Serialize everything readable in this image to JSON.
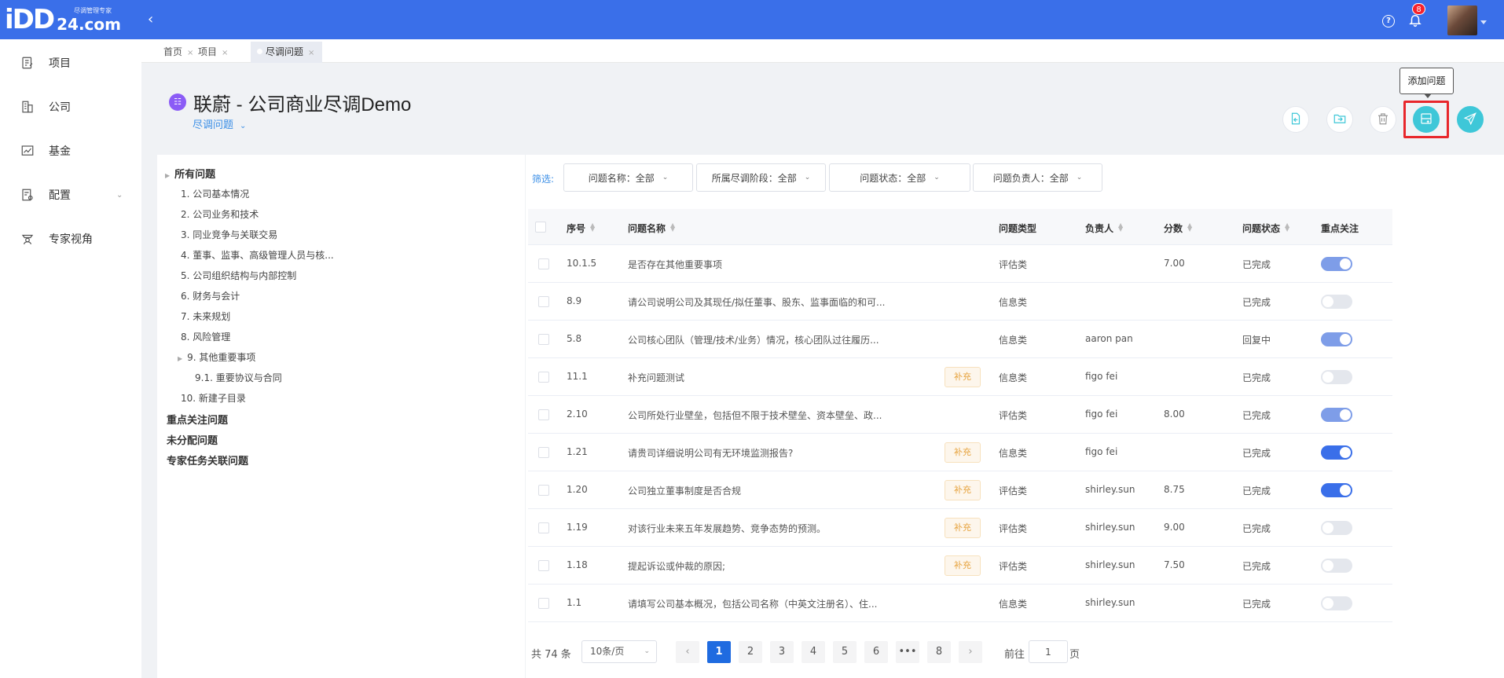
{
  "header": {
    "logo_mark": "iDD",
    "logo_domain": "24.com",
    "logo_tagline": "尽调管理专家",
    "notification_count": "8"
  },
  "sidebar": {
    "items": [
      {
        "label": "项目",
        "icon": "edit-doc-icon"
      },
      {
        "label": "公司",
        "icon": "building-icon"
      },
      {
        "label": "基金",
        "icon": "chart-icon"
      },
      {
        "label": "配置",
        "icon": "settings-doc-icon"
      },
      {
        "label": "专家视角",
        "icon": "expert-icon"
      }
    ]
  },
  "tabs": [
    {
      "label": "首页"
    },
    {
      "label": "项目"
    },
    {
      "label": "尽调问题"
    }
  ],
  "project": {
    "title": "联蔚 - 公司商业尽调Demo",
    "subtitle": "尽调问题"
  },
  "tooltip": "添加问题",
  "tree": {
    "root": "所有问题",
    "items": [
      "1. 公司基本情况",
      "2. 公司业务和技术",
      "3. 同业竞争与关联交易",
      "4. 董事、监事、高级管理人员与核...",
      "5. 公司组织结构与内部控制",
      "6. 财务与会计",
      "7. 未来规划",
      "8. 风险管理",
      "9. 其他重要事项",
      "9.1. 重要协议与合同",
      "10. 新建子目录"
    ],
    "groups": [
      "重点关注问题",
      "未分配问题",
      "专家任务关联问题"
    ]
  },
  "filters": {
    "label": "筛选:",
    "items": [
      "问题名称：全部",
      "所属尽调阶段：全部",
      "问题状态：全部",
      "问题负责人：全部"
    ]
  },
  "table": {
    "headers": [
      "序号",
      "问题名称",
      "问题类型",
      "负责人",
      "分数",
      "问题状态",
      "重点关注"
    ],
    "rows": [
      {
        "no": "10.1.5",
        "name": "是否存在其他重要事项",
        "tag": "",
        "type": "评估类",
        "owner": "",
        "score": "7.00",
        "status": "已完成",
        "focus": "on-light"
      },
      {
        "no": "8.9",
        "name": "请公司说明公司及其现任/拟任董事、股东、监事面临的和可...",
        "tag": "",
        "type": "信息类",
        "owner": "",
        "score": "",
        "status": "已完成",
        "focus": "off"
      },
      {
        "no": "5.8",
        "name": "公司核心团队（管理/技术/业务）情况，核心团队过往履历...",
        "tag": "",
        "type": "信息类",
        "owner": "aaron pan",
        "score": "",
        "status": "回复中",
        "focus": "on-light"
      },
      {
        "no": "11.1",
        "name": "补充问题测试",
        "tag": "补充",
        "type": "信息类",
        "owner": "figo fei",
        "score": "",
        "status": "已完成",
        "focus": "off"
      },
      {
        "no": "2.10",
        "name": "公司所处行业壁垒，包括但不限于技术壁垒、资本壁垒、政...",
        "tag": "",
        "type": "评估类",
        "owner": "figo fei",
        "score": "8.00",
        "status": "已完成",
        "focus": "on-light"
      },
      {
        "no": "1.21",
        "name": "请贵司详细说明公司有无环境监测报告?",
        "tag": "补充",
        "type": "信息类",
        "owner": "figo fei",
        "score": "",
        "status": "已完成",
        "focus": "on-dark"
      },
      {
        "no": "1.20",
        "name": "公司独立董事制度是否合规",
        "tag": "补充",
        "type": "评估类",
        "owner": "shirley.sun",
        "score": "8.75",
        "status": "已完成",
        "focus": "on-dark"
      },
      {
        "no": "1.19",
        "name": "对该行业未来五年发展趋势、竞争态势的预测。",
        "tag": "补充",
        "type": "评估类",
        "owner": "shirley.sun",
        "score": "9.00",
        "status": "已完成",
        "focus": "off"
      },
      {
        "no": "1.18",
        "name": "提起诉讼或仲裁的原因;",
        "tag": "补充",
        "type": "评估类",
        "owner": "shirley.sun",
        "score": "7.50",
        "status": "已完成",
        "focus": "off"
      },
      {
        "no": "1.1",
        "name": "请填写公司基本概况，包括公司名称（中英文注册名）、住...",
        "tag": "",
        "type": "信息类",
        "owner": "shirley.sun",
        "score": "",
        "status": "已完成",
        "focus": "off"
      }
    ]
  },
  "pagination": {
    "total": "共 74 条",
    "page_size": "10条/页",
    "pages": [
      "1",
      "2",
      "3",
      "4",
      "5",
      "6",
      "•••",
      "8"
    ],
    "current": "1",
    "goto_label": "前往",
    "goto_value": "1",
    "goto_unit": "页"
  },
  "colors": {
    "topbar": "#3a6fe9",
    "accent": "#3a8ee6",
    "teal": "#3ec7d8",
    "highlight": "#e8262b",
    "tag_text": "#e6a23c"
  }
}
